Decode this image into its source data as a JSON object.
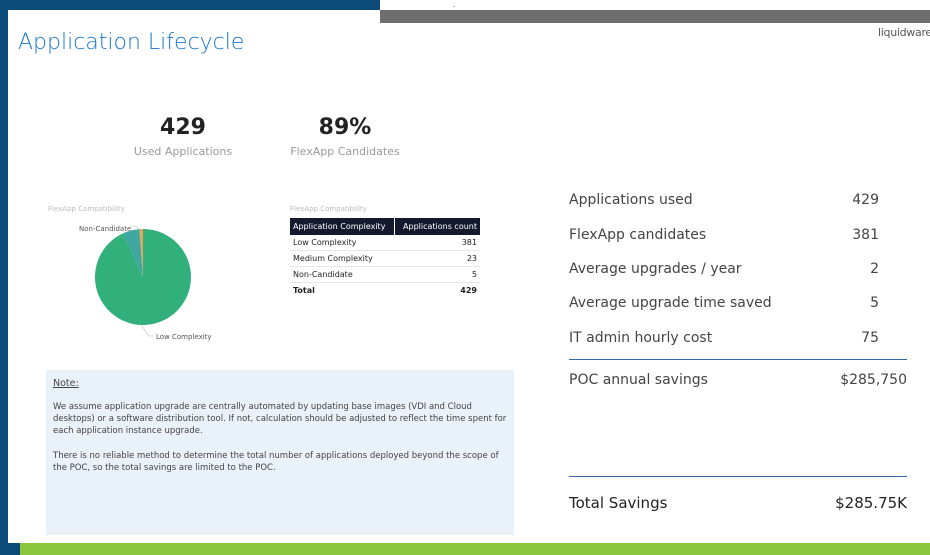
{
  "page": {
    "title": "Application Lifecycle",
    "logo": "liquidware"
  },
  "kpis": [
    {
      "value": "429",
      "label": "Used Applications"
    },
    {
      "value": "89%",
      "label": "FlexApp Candidates"
    }
  ],
  "pie_chart": {
    "caption": "FlexApp Compatibility",
    "labels": [
      "Non-Candidate",
      "Low Complexity"
    ],
    "colors": {
      "main": "#32b07c",
      "minor": "#e0a85a"
    }
  },
  "chart_data": {
    "type": "pie",
    "title": "FlexApp Compatibility",
    "categories": [
      "Low Complexity",
      "Medium Complexity",
      "Non-Candidate"
    ],
    "values": [
      381,
      23,
      5
    ]
  },
  "table": {
    "caption": "FlexApp Compatibility",
    "headers": [
      "Application Complexity",
      "Applications count"
    ],
    "rows": [
      [
        "Low Complexity",
        "381"
      ],
      [
        "Medium Complexity",
        "23"
      ],
      [
        "Non-Candidate",
        "5"
      ]
    ],
    "total": [
      "Total",
      "429"
    ]
  },
  "note": {
    "title": "Note:",
    "p1": "We assume application upgrade are centrally automated by updating base images (VDI and Cloud desktops) or a software distribution tool. If not, calculation should be adjusted to reflect the time spent for each application instance upgrade.",
    "p2": "There is no reliable method to determine the total number of applications deployed beyond the scope of the POC, so the total savings are limited to the POC."
  },
  "metrics": [
    {
      "label": "Applications used",
      "value": "429"
    },
    {
      "label": "FlexApp candidates",
      "value": "381"
    },
    {
      "label": "Average upgrades / year",
      "value": "2"
    },
    {
      "label": "Average upgrade time saved",
      "value": "5"
    },
    {
      "label": "IT admin hourly cost",
      "value": "75"
    }
  ],
  "poc": {
    "label": "POC annual savings",
    "value": "$285,750"
  },
  "total": {
    "label": "Total Savings",
    "value": "$285.75K"
  },
  "colors": {
    "accent": "#1877c9",
    "frame": "#0c4a7a",
    "green": "#8cc63f"
  }
}
